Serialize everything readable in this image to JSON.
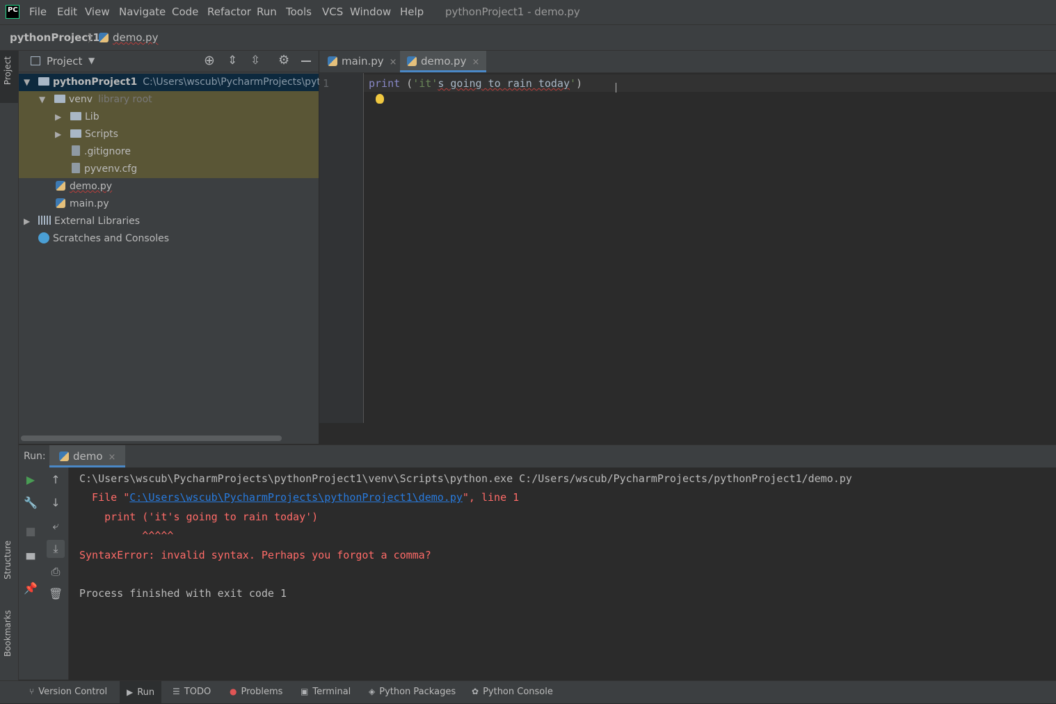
{
  "menu": {
    "logo": "PC",
    "items": [
      "File",
      "Edit",
      "View",
      "Navigate",
      "Code",
      "Refactor",
      "Run",
      "Tools",
      "VCS",
      "Window",
      "Help"
    ],
    "window_title": "pythonProject1 - demo.py"
  },
  "breadcrumb": {
    "project": "pythonProject1",
    "separator": "〉",
    "file": "demo.py"
  },
  "side_tabs": {
    "project": "Project",
    "structure": "Structure",
    "bookmarks": "Bookmarks"
  },
  "project_panel": {
    "title": "Project",
    "tree": {
      "root_name": "pythonProject1",
      "root_path": "C:\\Users\\wscub\\PycharmProjects\\python",
      "venv": "venv",
      "venv_hint": "library root",
      "lib": "Lib",
      "scripts": "Scripts",
      "gitignore": ".gitignore",
      "pyvenv": "pyvenv.cfg",
      "demo": "demo.py",
      "main": "main.py",
      "external": "External Libraries",
      "scratches": "Scratches and Consoles"
    }
  },
  "editor": {
    "tabs": {
      "main": "main.py",
      "demo": "demo.py"
    },
    "close_glyph": "×",
    "line_number": "1",
    "code": {
      "kw": "print",
      "open": " (",
      "str_part1": "'it'",
      "str_err": "s going to rain today",
      "str_part2": "'",
      "close": ")"
    }
  },
  "run": {
    "label": "Run:",
    "tab": "demo",
    "console": {
      "cmd": "C:\\Users\\wscub\\PycharmProjects\\pythonProject1\\venv\\Scripts\\python.exe C:/Users/wscub/PycharmProjects/pythonProject1/demo.py",
      "file_prefix": "  File \"",
      "file_link": "C:\\Users\\wscub\\PycharmProjects\\pythonProject1\\demo.py",
      "file_suffix": "\", line 1",
      "code_echo": "    print ('it's going to rain today')",
      "caret": "          ^^^^^",
      "error": "SyntaxError: invalid syntax. Perhaps you forgot a comma?",
      "exit": "Process finished with exit code 1"
    }
  },
  "statusbar": {
    "version_control": "Version Control",
    "run": "Run",
    "todo": "TODO",
    "problems": "Problems",
    "terminal": "Terminal",
    "python_packages": "Python Packages",
    "python_console": "Python Console"
  },
  "colors": {
    "accent": "#4a88c7",
    "error": "#ff6b68",
    "string": "#6a8759",
    "keyword": "#8888c6",
    "link": "#287bde"
  }
}
